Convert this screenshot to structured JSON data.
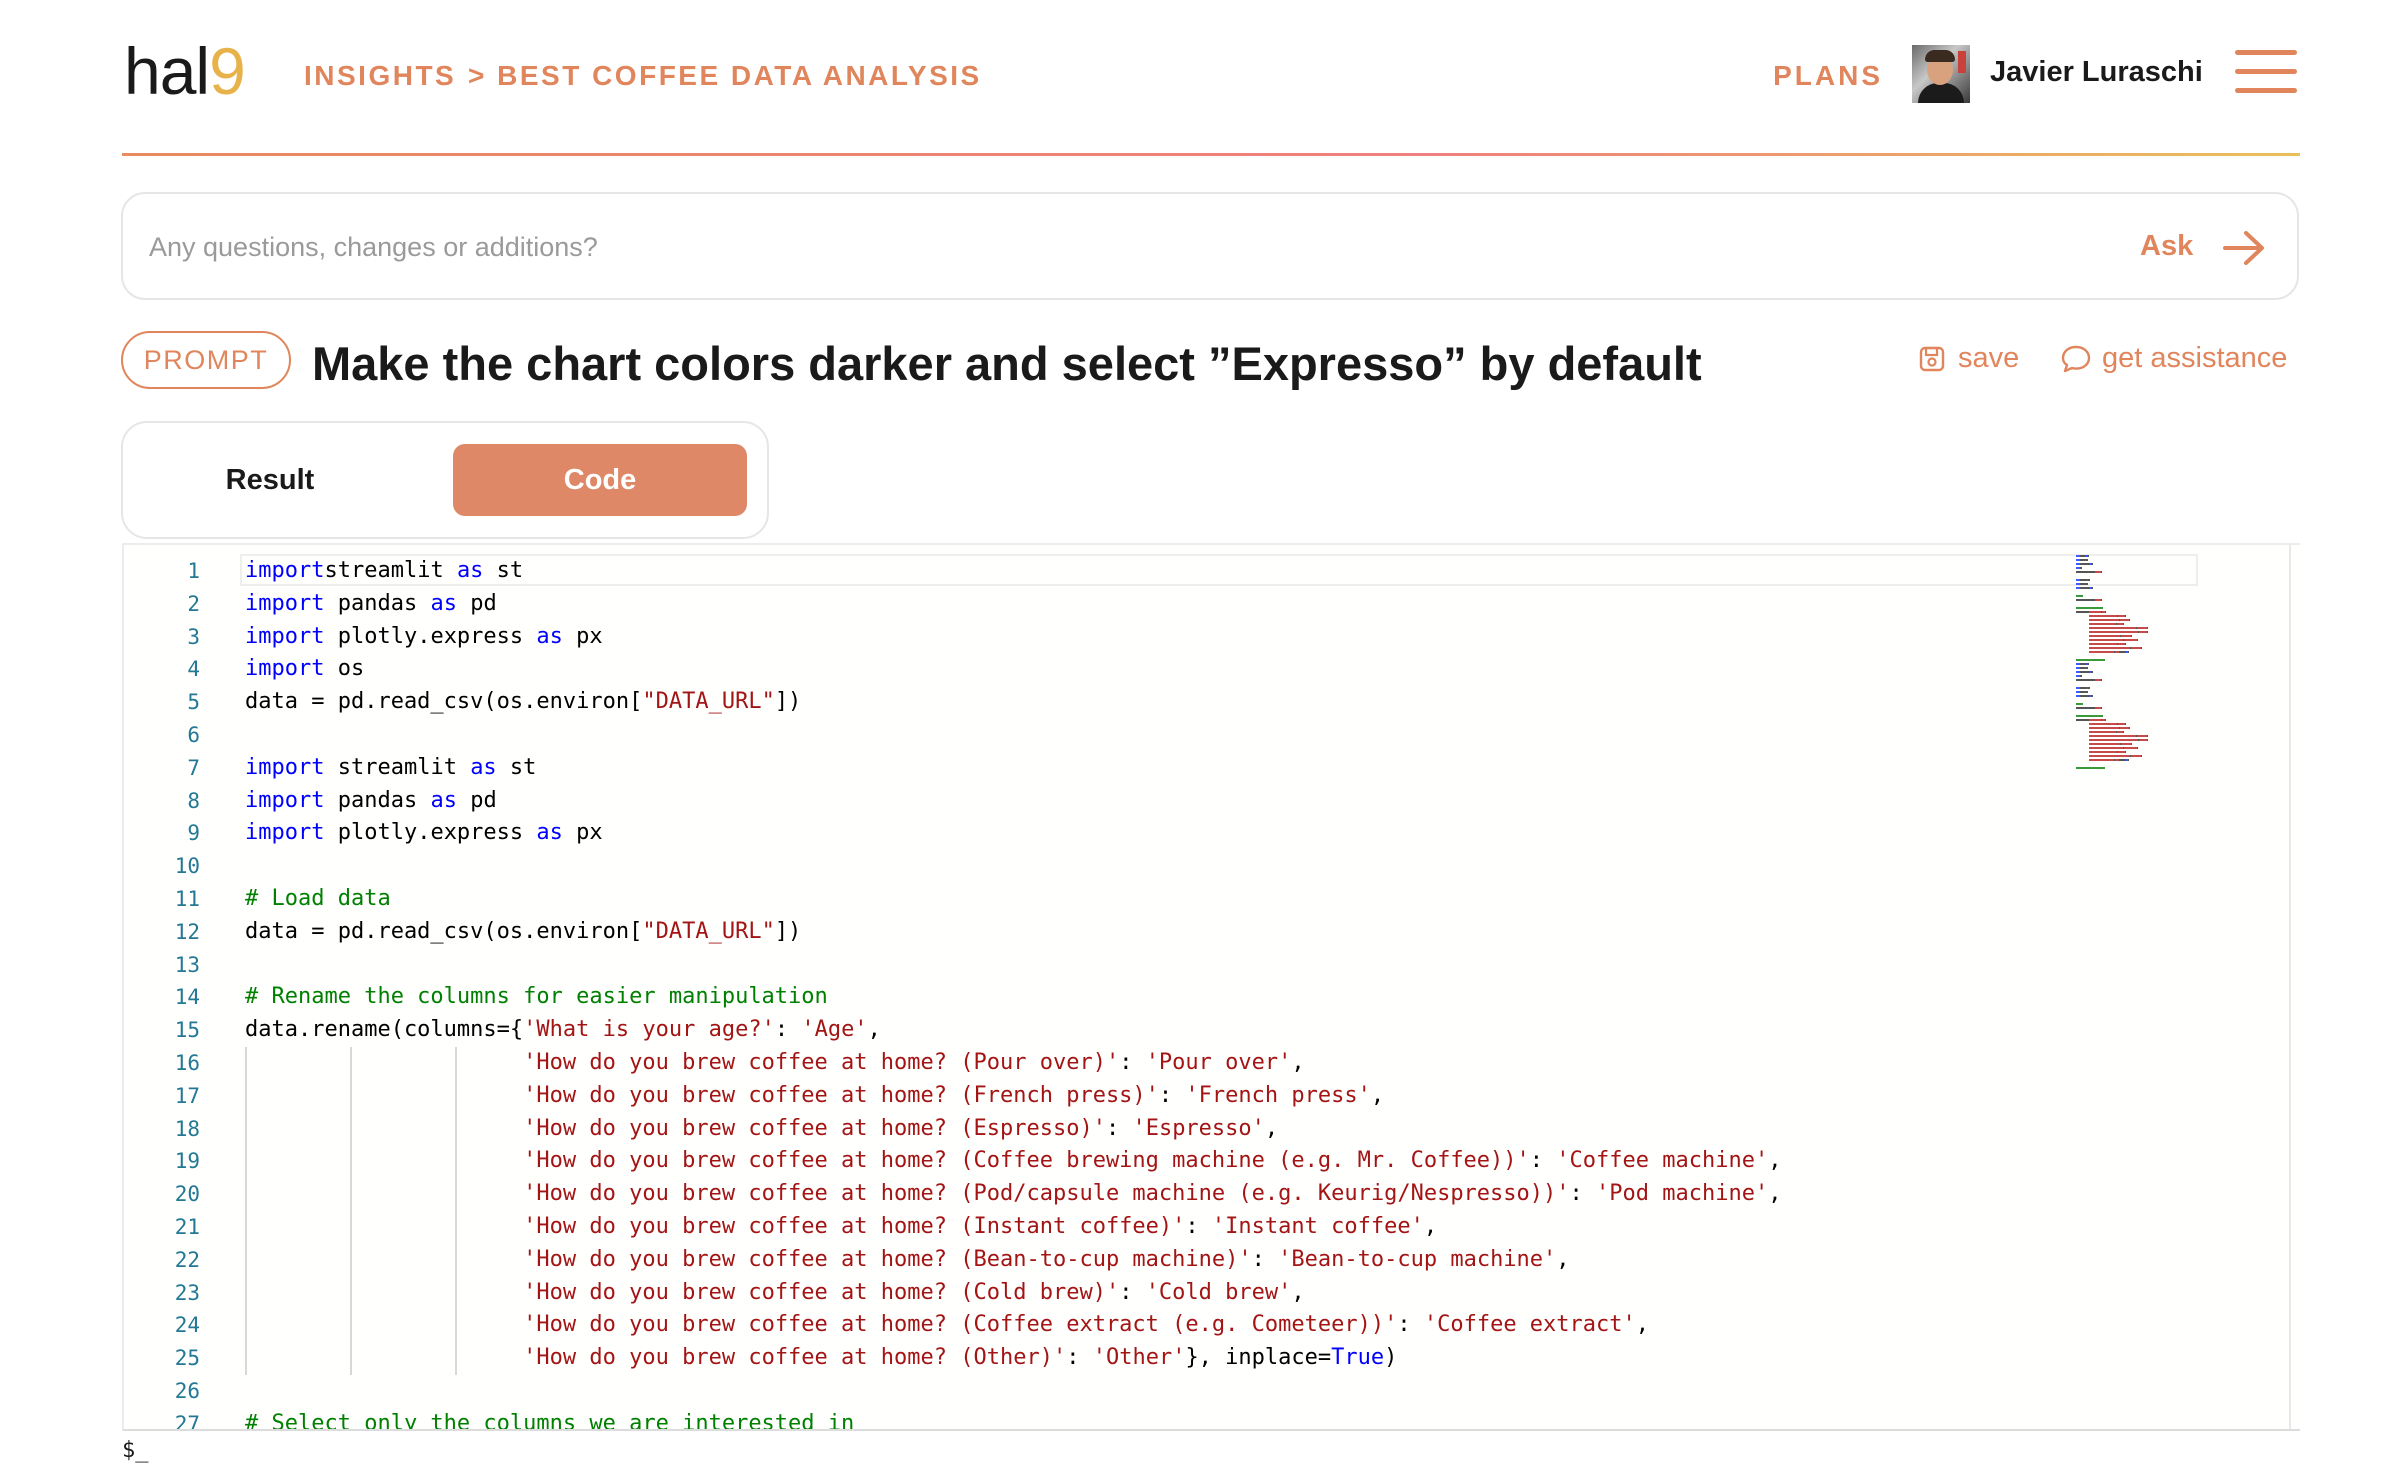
{
  "header": {
    "logo_text": "hal",
    "logo_accent": "9",
    "breadcrumbs": [
      "INSIGHTS",
      "> BEST COFFEE DATA ANALYSIS"
    ],
    "plans_label": "PLANS",
    "user_name": "Javier Luraschi",
    "accent_color": "#e0855c"
  },
  "ask": {
    "placeholder": "Any questions, changes or additions?",
    "button_label": "Ask"
  },
  "prompt": {
    "badge": "PROMPT",
    "text": "Make the chart colors darker and select ”Expresso” by default",
    "save_label": "save",
    "assist_label": "get assistance"
  },
  "tabs": {
    "result": "Result",
    "code": "Code",
    "active": "Code"
  },
  "editor": {
    "lines": [
      {
        "n": "1",
        "t": [
          [
            "kw",
            "import"
          ],
          [
            "",
            "streamlit "
          ],
          [
            "kw",
            "as"
          ],
          [
            "",
            " st"
          ]
        ]
      },
      {
        "n": "2",
        "t": [
          [
            "kw",
            "import"
          ],
          [
            "",
            " pandas "
          ],
          [
            "kw",
            "as"
          ],
          [
            "",
            " pd"
          ]
        ]
      },
      {
        "n": "3",
        "t": [
          [
            "kw",
            "import"
          ],
          [
            "",
            " plotly.express "
          ],
          [
            "kw",
            "as"
          ],
          [
            "",
            " px"
          ]
        ]
      },
      {
        "n": "4",
        "t": [
          [
            "kw",
            "import"
          ],
          [
            "",
            " os"
          ]
        ]
      },
      {
        "n": "5",
        "t": [
          [
            "",
            "data = pd.read_csv(os.environ["
          ],
          [
            "st",
            "\"DATA_URL\""
          ],
          [
            "",
            "])"
          ]
        ]
      },
      {
        "n": "6",
        "t": []
      },
      {
        "n": "7",
        "t": [
          [
            "kw",
            "import"
          ],
          [
            "",
            " streamlit "
          ],
          [
            "kw",
            "as"
          ],
          [
            "",
            " st"
          ]
        ]
      },
      {
        "n": "8",
        "t": [
          [
            "kw",
            "import"
          ],
          [
            "",
            " pandas "
          ],
          [
            "kw",
            "as"
          ],
          [
            "",
            " pd"
          ]
        ]
      },
      {
        "n": "9",
        "t": [
          [
            "kw",
            "import"
          ],
          [
            "",
            " plotly.express "
          ],
          [
            "kw",
            "as"
          ],
          [
            "",
            " px"
          ]
        ]
      },
      {
        "n": "10",
        "t": []
      },
      {
        "n": "11",
        "t": [
          [
            "cm",
            "# Load data"
          ]
        ]
      },
      {
        "n": "12",
        "t": [
          [
            "",
            "data = pd.read_csv(os.environ["
          ],
          [
            "st",
            "\"DATA_URL\""
          ],
          [
            "",
            "])"
          ]
        ]
      },
      {
        "n": "13",
        "t": []
      },
      {
        "n": "14",
        "t": [
          [
            "cm",
            "# Rename the columns for easier manipulation"
          ]
        ]
      },
      {
        "n": "15",
        "t": [
          [
            "",
            "data.rename(columns={"
          ],
          [
            "st",
            "'What is your age?'"
          ],
          [
            "",
            ": "
          ],
          [
            "st",
            "'Age'"
          ],
          [
            "",
            ","
          ]
        ]
      },
      {
        "n": "16",
        "t": [
          [
            "",
            "                     "
          ],
          [
            "st",
            "'How do you brew coffee at home? (Pour over)'"
          ],
          [
            "",
            ": "
          ],
          [
            "st",
            "'Pour over'"
          ],
          [
            "",
            ","
          ]
        ]
      },
      {
        "n": "17",
        "t": [
          [
            "",
            "                     "
          ],
          [
            "st",
            "'How do you brew coffee at home? (French press)'"
          ],
          [
            "",
            ": "
          ],
          [
            "st",
            "'French press'"
          ],
          [
            "",
            ","
          ]
        ]
      },
      {
        "n": "18",
        "t": [
          [
            "",
            "                     "
          ],
          [
            "st",
            "'How do you brew coffee at home? (Espresso)'"
          ],
          [
            "",
            ": "
          ],
          [
            "st",
            "'Espresso'"
          ],
          [
            "",
            ","
          ]
        ]
      },
      {
        "n": "19",
        "t": [
          [
            "",
            "                     "
          ],
          [
            "st",
            "'How do you brew coffee at home? (Coffee brewing machine (e.g. Mr. Coffee))'"
          ],
          [
            "",
            ": "
          ],
          [
            "st",
            "'Coffee machine'"
          ],
          [
            "",
            ","
          ]
        ]
      },
      {
        "n": "20",
        "t": [
          [
            "",
            "                     "
          ],
          [
            "st",
            "'How do you brew coffee at home? (Pod/capsule machine (e.g. Keurig/Nespresso))'"
          ],
          [
            "",
            ": "
          ],
          [
            "st",
            "'Pod machine'"
          ],
          [
            "",
            ","
          ]
        ]
      },
      {
        "n": "21",
        "t": [
          [
            "",
            "                     "
          ],
          [
            "st",
            "'How do you brew coffee at home? (Instant coffee)'"
          ],
          [
            "",
            ": "
          ],
          [
            "st",
            "'Instant coffee'"
          ],
          [
            "",
            ","
          ]
        ]
      },
      {
        "n": "22",
        "t": [
          [
            "",
            "                     "
          ],
          [
            "st",
            "'How do you brew coffee at home? (Bean-to-cup machine)'"
          ],
          [
            "",
            ": "
          ],
          [
            "st",
            "'Bean-to-cup machine'"
          ],
          [
            "",
            ","
          ]
        ]
      },
      {
        "n": "23",
        "t": [
          [
            "",
            "                     "
          ],
          [
            "st",
            "'How do you brew coffee at home? (Cold brew)'"
          ],
          [
            "",
            ": "
          ],
          [
            "st",
            "'Cold brew'"
          ],
          [
            "",
            ","
          ]
        ]
      },
      {
        "n": "24",
        "t": [
          [
            "",
            "                     "
          ],
          [
            "st",
            "'How do you brew coffee at home? (Coffee extract (e.g. Cometeer))'"
          ],
          [
            "",
            ": "
          ],
          [
            "st",
            "'Coffee extract'"
          ],
          [
            "",
            ","
          ]
        ]
      },
      {
        "n": "25",
        "t": [
          [
            "",
            "                     "
          ],
          [
            "st",
            "'How do you brew coffee at home? (Other)'"
          ],
          [
            "",
            ": "
          ],
          [
            "st",
            "'Other'"
          ],
          [
            "",
            "}, inplace="
          ],
          [
            "kw",
            "True"
          ],
          [
            "",
            ")"
          ]
        ]
      },
      {
        "n": "26",
        "t": []
      },
      {
        "n": "27",
        "t": [
          [
            "cm",
            "# Select only the columns we are interested in"
          ]
        ]
      }
    ]
  },
  "terminal": {
    "prompt": "$_"
  }
}
